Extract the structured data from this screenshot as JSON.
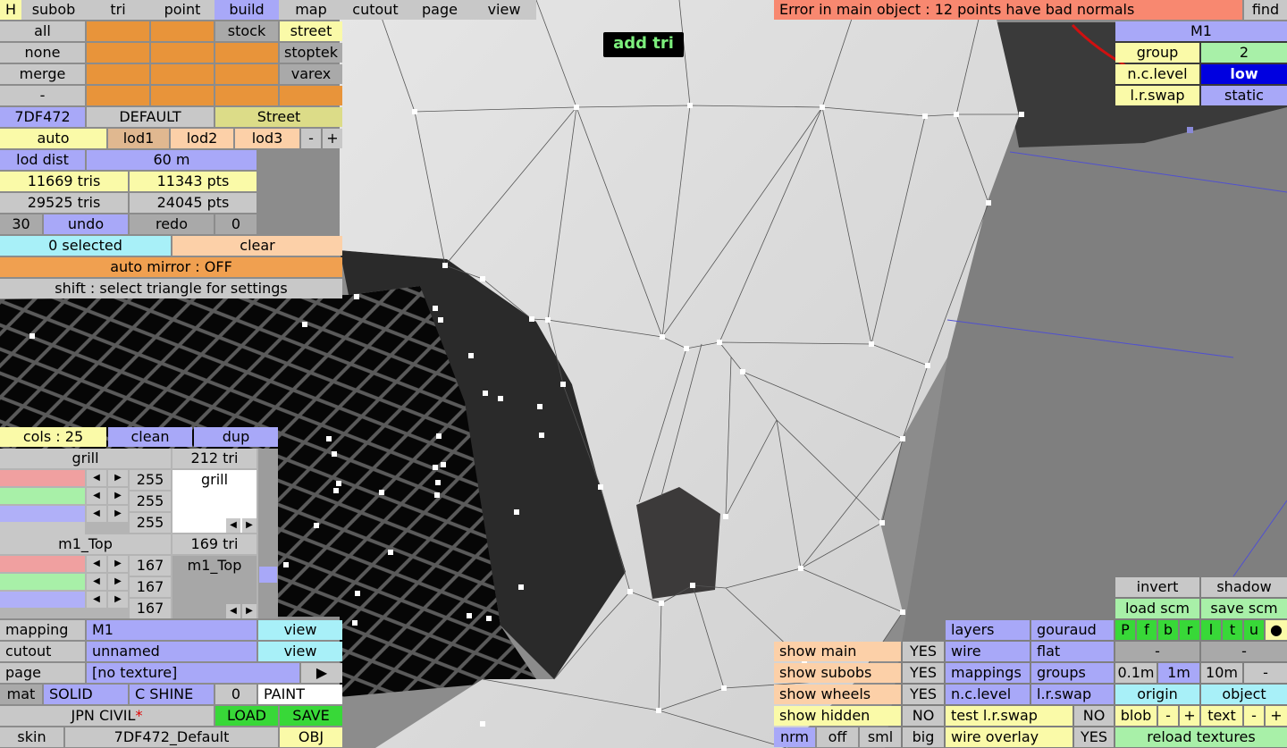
{
  "top_menu": [
    "subob",
    "tri",
    "point",
    "build",
    "map",
    "cutout",
    "page",
    "view"
  ],
  "help_label": "H",
  "error_text": "Error in main object : 12 points have bad normals",
  "find_label": "find",
  "hint_tag": "add tri",
  "select": {
    "all": "all",
    "none": "none",
    "merge": "merge",
    "dash": "-"
  },
  "filters": {
    "stock": "stock",
    "street": "street",
    "stoptek": "stoptek",
    "varex": "varex"
  },
  "car": {
    "code": "7DF472",
    "preset": "DEFAULT",
    "category": "Street"
  },
  "lod": {
    "auto": "auto",
    "lod1": "lod1",
    "lod2": "lod2",
    "lod3": "lod3",
    "minus": "-",
    "plus": "+",
    "dist_label": "lod dist",
    "dist_value": "60 m",
    "tris1": "11669 tris",
    "pts1": "11343 pts",
    "tris2": "29525 tris",
    "pts2": "24045 pts"
  },
  "history": {
    "count": "30",
    "undo": "undo",
    "redo": "redo",
    "redo_count": "0"
  },
  "selection": {
    "selected": "0 selected",
    "clear": "clear",
    "mirror": "auto mirror : OFF",
    "shift_hint": "shift : select triangle for settings"
  },
  "colours": {
    "cols": "cols : 25",
    "clean": "clean",
    "dup": "dup"
  },
  "mat1": {
    "name": "grill",
    "tris": "212 tri",
    "list_item": "grill",
    "r": "255",
    "g": "255",
    "b": "255"
  },
  "mat2": {
    "name": "m1_Top",
    "tris": "169 tri",
    "list_item": "m1_Top",
    "r": "167",
    "g": "167",
    "b": "167"
  },
  "bottom_left": {
    "mapping_label": "mapping",
    "mapping_value": "M1",
    "view1": "view",
    "cutout_label": "cutout",
    "cutout_value": "unnamed",
    "view2": "view",
    "page_label": "page",
    "page_value": "[no texture]",
    "play": "▶",
    "mat_label": "mat",
    "solid": "SOLID",
    "cshine": "C SHINE",
    "zero": "0",
    "paint": "PAINT",
    "jpn": "JPN CIVIL",
    "star": "*",
    "load": "LOAD",
    "save": "SAVE",
    "skin_label": "skin",
    "skin_value": "7DF472_Default",
    "obj": "OBJ"
  },
  "mapping_panel": {
    "name": "M1",
    "group_label": "group",
    "group_value": "2",
    "nc_label": "n.c.level",
    "nc_value": "low",
    "lr_label": "l.r.swap",
    "lr_value": "static"
  },
  "show": [
    {
      "label": "show main",
      "value": "YES"
    },
    {
      "label": "show subobs",
      "value": "YES"
    },
    {
      "label": "show wheels",
      "value": "YES"
    },
    {
      "label": "show hidden",
      "value": "NO"
    }
  ],
  "view_modes": {
    "nrm": "nrm",
    "off": "off",
    "sml": "sml",
    "big": "big"
  },
  "overlays": {
    "layers": "layers",
    "gouraud": "gouraud",
    "wire": "wire",
    "flat": "flat",
    "mappings": "mappings",
    "groups": "groups",
    "nc": "n.c.level",
    "lrswap": "l.r.swap",
    "test_lr": "test l.r.swap",
    "test_lr_value": "NO",
    "wire_overlay": "wire overlay",
    "wire_overlay_value": "YES"
  },
  "right_tools": {
    "invert": "invert",
    "shadow": "shadow",
    "load_scm": "load scm",
    "save_scm": "save scm",
    "views": [
      "P",
      "f",
      "b",
      "r",
      "l",
      "t",
      "u",
      "●"
    ],
    "dash1": "-",
    "dash2": "-",
    "scale": [
      "0.1m",
      "1m",
      "10m",
      "-"
    ],
    "origin": "origin",
    "object": "object",
    "blob": "blob",
    "text": "text",
    "minus": "-",
    "plus": "+",
    "reload": "reload textures"
  },
  "colors": {
    "accent_blue": "#a8a8f8",
    "orange": "#f0a050",
    "error": "#f88870",
    "green": "#38d838"
  }
}
